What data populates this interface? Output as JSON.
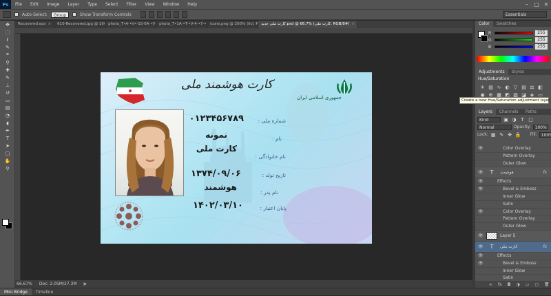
{
  "app": {
    "logo": "Ps"
  },
  "menu": [
    "File",
    "Edit",
    "Image",
    "Layer",
    "Type",
    "Select",
    "Filter",
    "View",
    "Window",
    "Help"
  ],
  "window_controls": [
    "–",
    "□",
    "✕"
  ],
  "options_bar": {
    "auto_select_label": "Auto-Select:",
    "auto_select_value": "Group",
    "transform_label": "Show Transform Controls",
    "workspace": "Essentials"
  },
  "tabs": [
    {
      "label": "Recovered.eps",
      "active": false
    },
    {
      "label": "610-Recovered.jpg @ 100...",
      "active": false
    },
    {
      "label": "photo_T•A-•V•-15-0A-•V-Recovered.jpg",
      "active": false
    },
    {
      "label": "photo_T•1A-•T-•V-4-•7-•Recovered.jpg",
      "active": false
    },
    {
      "label": "icons.png @ 200% (Iicl, RGB...",
      "active": false
    },
    {
      "label": "کارت ملی جدید.psd @ 66.7% (کارت ملی, RGB/8#)",
      "active": true
    }
  ],
  "status": {
    "zoom": "66.67%",
    "doc": "Doc: 2.05M/27.3M"
  },
  "bottom_tabs": [
    "Mini Bridge",
    "Timeline"
  ],
  "tools": [
    "move",
    "marquee",
    "lasso",
    "quick-select",
    "crop",
    "eyedropper",
    "heal",
    "brush",
    "stamp",
    "history-brush",
    "eraser",
    "gradient",
    "blur",
    "dodge",
    "pen",
    "type",
    "path-select",
    "shape",
    "hand",
    "zoom"
  ],
  "panels": {
    "color_tabs": [
      "Color",
      "Swatches"
    ],
    "color_sliders": [
      {
        "label": "R",
        "value": "255",
        "color": "#ff0000"
      },
      {
        "label": "G",
        "value": "255",
        "color": "#00ff00"
      },
      {
        "label": "B",
        "value": "255",
        "color": "#0000ff"
      }
    ],
    "adjust_tabs": [
      "Adjustments",
      "Styles"
    ],
    "adjust_title": "Hue/Saturation",
    "tooltip": "Create a new Hue/Saturation adjustment layer",
    "layers_tabs": [
      "Layers",
      "Channels",
      "Paths"
    ],
    "kind": "Kind",
    "blend": "Normal",
    "opacity_label": "Opacity:",
    "opacity": "100%",
    "lock_label": "Lock:",
    "fill_label": "Fill:",
    "fill": "100%",
    "layers": [
      {
        "type": "sub",
        "label": "Color Overlay",
        "eye": true
      },
      {
        "type": "sub",
        "label": "Pattern Overlay",
        "eye": false
      },
      {
        "type": "sub",
        "label": "Outer Glow",
        "eye": false
      },
      {
        "type": "main",
        "label": "هوشمند",
        "thumb": "T",
        "fx": true
      },
      {
        "type": "eff",
        "label": "Effects",
        "eye": true
      },
      {
        "type": "sub",
        "label": "Bevel & Emboss",
        "eye": true
      },
      {
        "type": "sub",
        "label": "Inner Glow",
        "eye": false
      },
      {
        "type": "sub",
        "label": "Satin",
        "eye": false
      },
      {
        "type": "sub",
        "label": "Color Overlay",
        "eye": true
      },
      {
        "type": "sub",
        "label": "Pattern Overlay",
        "eye": false
      },
      {
        "type": "sub",
        "label": "Outer Glow",
        "eye": false
      },
      {
        "type": "main",
        "label": "Layer 5",
        "thumb": "check",
        "fx": false
      },
      {
        "type": "main sel",
        "label": "کارت ملی",
        "thumb": "T",
        "fx": true
      },
      {
        "type": "eff",
        "label": "Effects",
        "eye": true
      },
      {
        "type": "sub",
        "label": "Bevel & Emboss",
        "eye": true
      },
      {
        "type": "sub",
        "label": "Inner Glow",
        "eye": false
      },
      {
        "type": "sub",
        "label": "Satin",
        "eye": false
      },
      {
        "type": "sub",
        "label": "Color Overlay",
        "eye": true
      },
      {
        "type": "sub",
        "label": "Pattern Overlay",
        "eye": false
      },
      {
        "type": "sub",
        "label": "Outer Glow",
        "eye": false
      }
    ]
  },
  "card": {
    "title": "کارت هوشمند ملی",
    "republic": "جمهوری اسلامی ایران",
    "national_id_label": "شماره ملی :",
    "national_id": "۰۱۲۳۴۵۶۷۸۹",
    "name_label": "نام :",
    "name": "نمونه",
    "surname_label": "نام خانوادگی :",
    "surname": "کارت ملی",
    "birth_label": "تاریخ تولد :",
    "birth": "۱۳۷۴/۰۹/۰۶",
    "father_label": "نام پدر :",
    "father": "هوشمند",
    "expiry_label": "پایان اعتبار :",
    "expiry": "۱۴۰۲/۰۳/۱۰",
    "emblem_color": "#0b7a3f"
  }
}
